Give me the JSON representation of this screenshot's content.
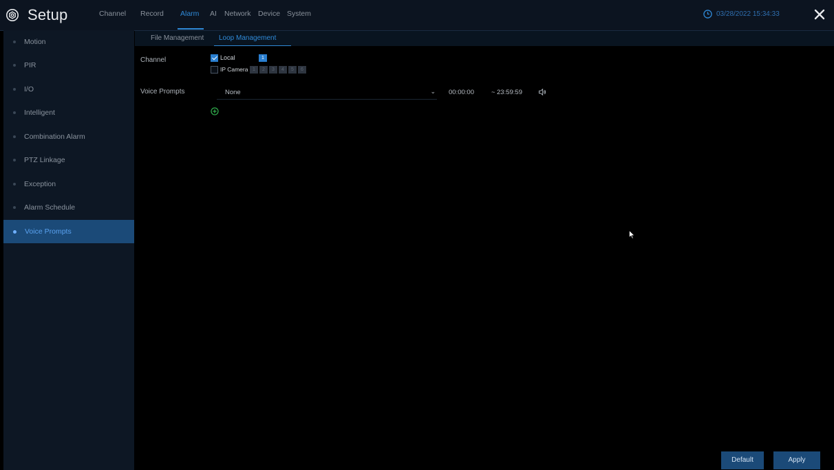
{
  "header": {
    "app_title": "Setup",
    "tabs": [
      {
        "label": "Channel",
        "active": false
      },
      {
        "label": "Record",
        "active": false
      },
      {
        "label": "Alarm",
        "active": true
      },
      {
        "label": "AI",
        "active": false
      },
      {
        "label": "Network",
        "active": false
      },
      {
        "label": "Device",
        "active": false
      },
      {
        "label": "System",
        "active": false
      }
    ],
    "datetime": "03/28/2022 15:34:33",
    "accent_color": "#2f8ad8"
  },
  "sidebar": {
    "items": [
      {
        "label": "Motion",
        "active": false
      },
      {
        "label": "PIR",
        "active": false
      },
      {
        "label": "I/O",
        "active": false
      },
      {
        "label": "Intelligent",
        "active": false
      },
      {
        "label": "Combination Alarm",
        "active": false
      },
      {
        "label": "PTZ Linkage",
        "active": false
      },
      {
        "label": "Exception",
        "active": false
      },
      {
        "label": "Alarm Schedule",
        "active": false
      },
      {
        "label": "Voice Prompts",
        "active": true
      }
    ]
  },
  "subtabs": [
    {
      "label": "File Management",
      "active": false
    },
    {
      "label": "Loop Management",
      "active": true
    }
  ],
  "form": {
    "channel_label": "Channel",
    "local_label": "Local",
    "local_checked": true,
    "local_channels": [
      "1"
    ],
    "ip_camera_label": "IP Camera",
    "ip_camera_checked": false,
    "ip_channels": [
      "1",
      "2",
      "3",
      "4",
      "5",
      "6"
    ],
    "voice_prompts_label": "Voice Prompts",
    "voice_prompt_value": "None",
    "start_time": "00:00:00",
    "end_time": "23:59:59",
    "time_separator": "~"
  },
  "footer": {
    "default_label": "Default",
    "apply_label": "Apply"
  }
}
